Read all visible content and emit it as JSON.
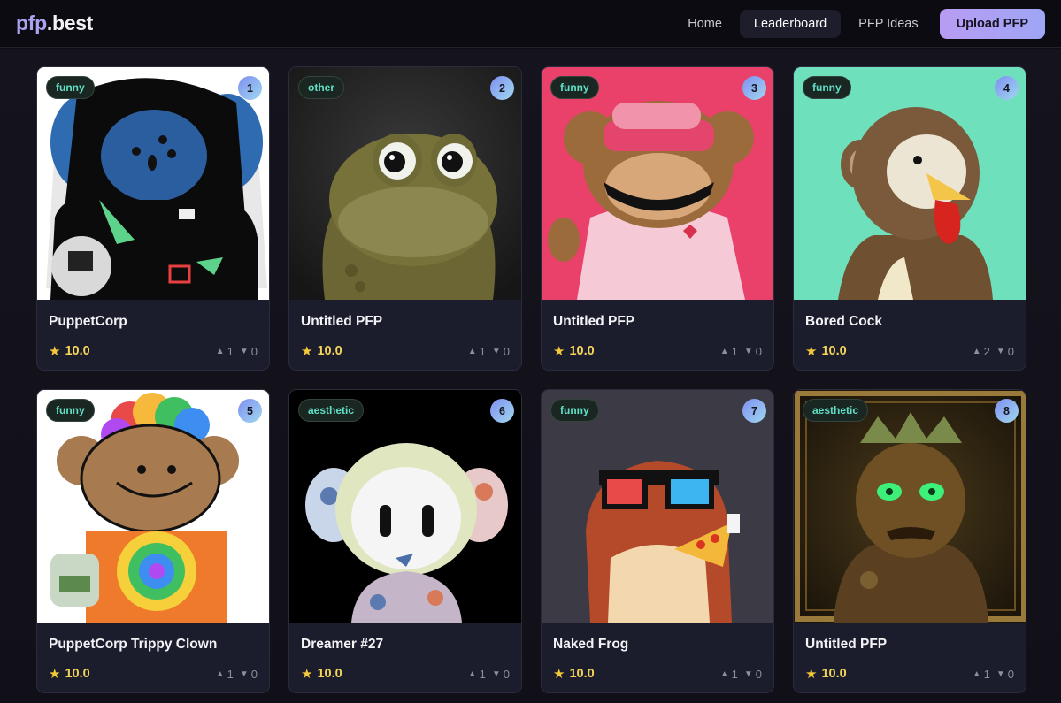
{
  "header": {
    "logo_prefix": "pfp",
    "logo_suffix": ".best",
    "nav": [
      {
        "label": "Home"
      },
      {
        "label": "Leaderboard"
      },
      {
        "label": "PFP Ideas"
      }
    ],
    "upload_label": "Upload PFP"
  },
  "icons": {
    "star": "star-icon",
    "upvote": "upvote-arrow-icon",
    "downvote": "downvote-arrow-icon"
  },
  "colors": {
    "tag_text": "#5fe0c6",
    "score": "#f3d35a",
    "upload_gradient_start": "#b79cf2",
    "upload_gradient_end": "#9fa6f5"
  },
  "cards": [
    {
      "tag": "funny",
      "rank": "1",
      "title": "PuppetCorp",
      "score": "10.0",
      "up": "1",
      "down": "0"
    },
    {
      "tag": "other",
      "rank": "2",
      "title": "Untitled PFP",
      "score": "10.0",
      "up": "1",
      "down": "0"
    },
    {
      "tag": "funny",
      "rank": "3",
      "title": "Untitled PFP",
      "score": "10.0",
      "up": "1",
      "down": "0"
    },
    {
      "tag": "funny",
      "rank": "4",
      "title": "Bored Cock",
      "score": "10.0",
      "up": "2",
      "down": "0"
    },
    {
      "tag": "funny",
      "rank": "5",
      "title": "PuppetCorp Trippy Clown",
      "score": "10.0",
      "up": "1",
      "down": "0"
    },
    {
      "tag": "aesthetic",
      "rank": "6",
      "title": "Dreamer #27",
      "score": "10.0",
      "up": "1",
      "down": "0"
    },
    {
      "tag": "funny",
      "rank": "7",
      "title": "Naked Frog",
      "score": "10.0",
      "up": "1",
      "down": "0"
    },
    {
      "tag": "aesthetic",
      "rank": "8",
      "title": "Untitled PFP",
      "score": "10.0",
      "up": "1",
      "down": "0"
    }
  ]
}
